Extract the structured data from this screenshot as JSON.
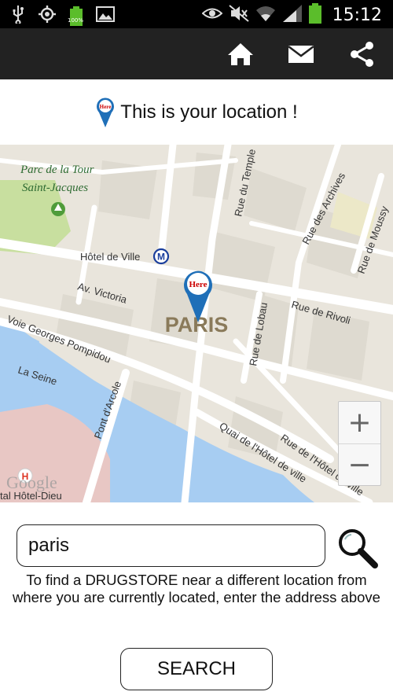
{
  "status_bar": {
    "battery_percent": "100%",
    "time": "15:12",
    "icons_left": [
      "usb-icon",
      "gps-icon",
      "battery-small-icon",
      "image-icon"
    ],
    "icons_right": [
      "eye-icon",
      "mute-icon",
      "wifi-icon",
      "signal-icon",
      "battery-icon"
    ]
  },
  "action_bar": {
    "buttons": [
      "home-icon",
      "mail-icon",
      "share-icon"
    ]
  },
  "location_header": {
    "icon": "here-pin-icon",
    "text": "This is your location !"
  },
  "map": {
    "city_label": "PARIS",
    "marker_label": "Here",
    "streets": {
      "rue_du_temple": "Rue du Temple",
      "rue_des_archives": "Rue des Archives",
      "rue_de_moussy": "Rue de Moussy",
      "hotel_de_ville": "Hôtel de Ville",
      "av_victoria": "Av. Victoria",
      "rue_de_rivoli": "Rue de Rivoli",
      "rue_de_lobau": "Rue de Lobau",
      "voie_georges_pompidou": "Voie Georges Pompidou",
      "la_seine": "La Seine",
      "pont_darcole": "Pont d'Arcole",
      "quai_hotel_de_ville": "Quai de l'Hôtel de ville",
      "rue_hotel_de_ville": "Rue de l'Hôtel de ville",
      "hotel_dieu": "tal Hôtel-Dieu"
    },
    "park": {
      "line1": "Parc de la Tour",
      "line2": "Saint-Jacques"
    },
    "metro_icon": "metro-icon",
    "watermark": "Google",
    "zoom_in": "+",
    "zoom_out": "−"
  },
  "search": {
    "value": "paris",
    "placeholder": "",
    "icon": "magnifier-icon",
    "help_text": "To find a DRUGSTORE near a different location from where you are currently located, enter the address above",
    "button_label": "SEARCH"
  },
  "colors": {
    "status_bg": "#000000",
    "action_bar_bg": "#222222",
    "map_land": "#e9e5dc",
    "map_water": "#a7cdf2",
    "map_park": "#c8df9f",
    "marker_blue": "#1f6fb8"
  }
}
